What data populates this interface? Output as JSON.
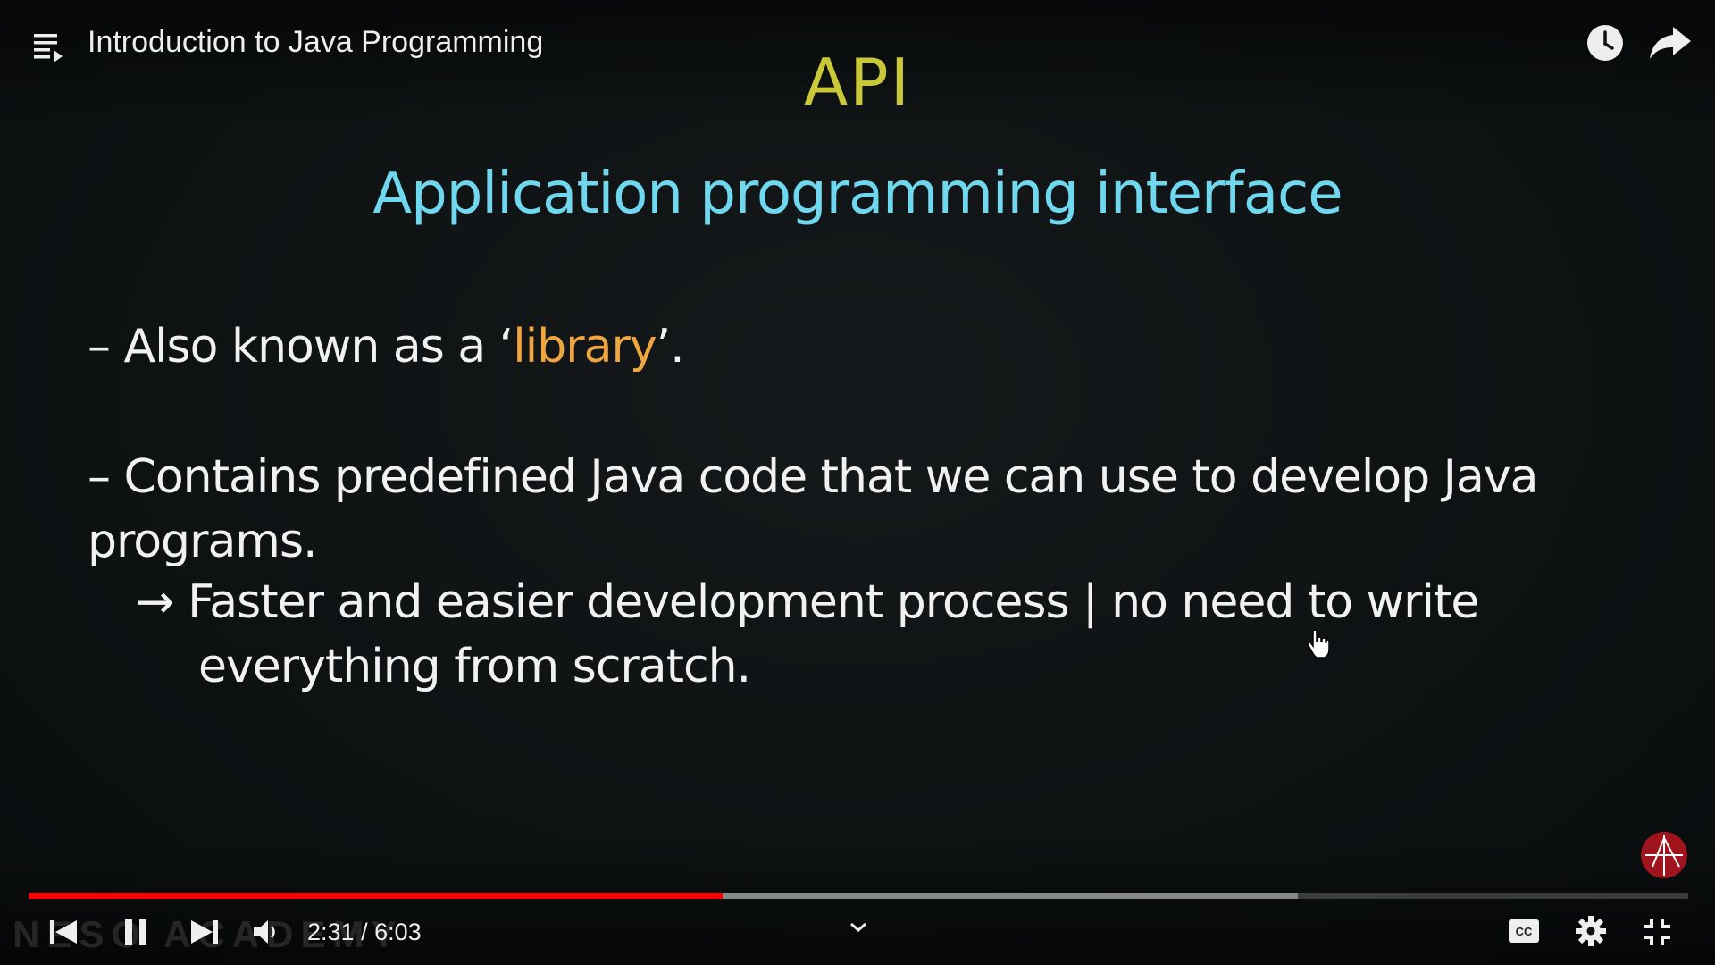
{
  "player": {
    "title": "Introduction to Java Programming",
    "current_time": "2:31",
    "separator": "/",
    "duration": "6:03",
    "progress_fraction": 0.418,
    "buffered_fraction": 0.765,
    "progress_color": "#ff0000"
  },
  "slide": {
    "heading": "API",
    "subheading": "Application programming interface",
    "bullet1": {
      "prefix": "–  Also known as a ‘",
      "highlight": "library",
      "suffix": "’."
    },
    "bullet2": {
      "line1": "– Contains predefined Java code that we can use to develop Java",
      "line2": "programs."
    },
    "bullet3": {
      "arrow": "→",
      "line1": "Faster and easier development process | no need to write",
      "line2": "everything from scratch."
    },
    "colors": {
      "heading": "#c9c838",
      "subheading": "#6fd8ee",
      "highlight": "#f0a640"
    }
  },
  "watermark": {
    "text": "NESO ACADEMY"
  },
  "icons": [
    "playlist-icon",
    "watch-later-icon",
    "share-icon",
    "previous-icon",
    "pause-icon",
    "next-icon",
    "volume-icon",
    "chevron-down-icon",
    "captions-icon",
    "settings-icon",
    "exit-fullscreen-icon",
    "channel-logo-icon"
  ]
}
